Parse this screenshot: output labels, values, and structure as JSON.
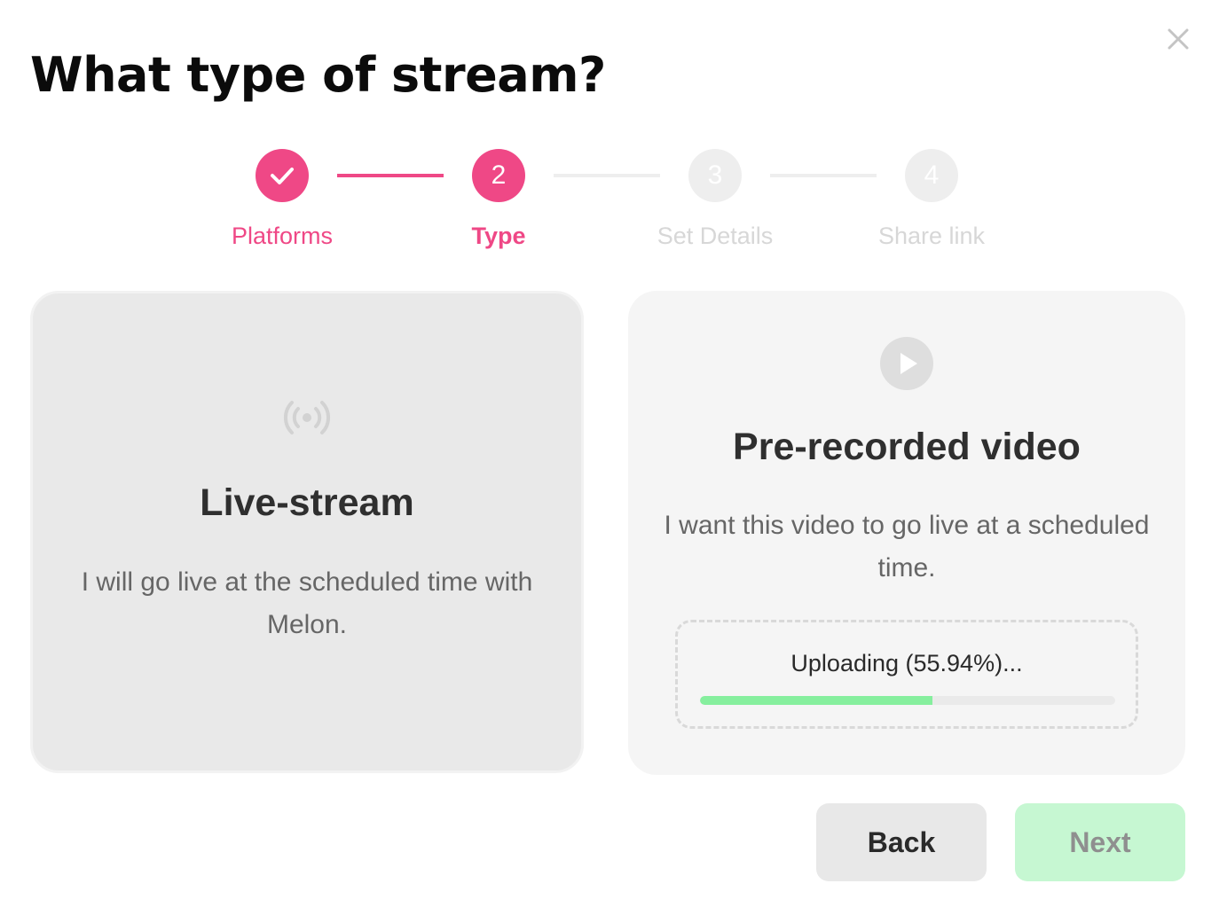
{
  "dialog": {
    "title": "What type of stream?"
  },
  "stepper": {
    "steps": [
      {
        "label": "Platforms",
        "number": "",
        "state": "completed"
      },
      {
        "label": "Type",
        "number": "2",
        "state": "current"
      },
      {
        "label": "Set Details",
        "number": "3",
        "state": "pending"
      },
      {
        "label": "Share link",
        "number": "4",
        "state": "pending"
      }
    ]
  },
  "options": {
    "live": {
      "icon": "broadcast-icon",
      "title": "Live-stream",
      "description": "I will go live at the scheduled time with Melon."
    },
    "prerecorded": {
      "icon": "play-icon",
      "title": "Pre-recorded video",
      "description": "I want this video to go live at a scheduled time.",
      "upload": {
        "status_text": "Uploading (55.94%)...",
        "progress_percent": 55.94
      }
    }
  },
  "footer": {
    "back_label": "Back",
    "next_label": "Next"
  },
  "colors": {
    "accent": "#ef4886",
    "step_pending": "#eeeeee",
    "progress": "#86ef9e",
    "next_button": "#c6f7d2"
  }
}
